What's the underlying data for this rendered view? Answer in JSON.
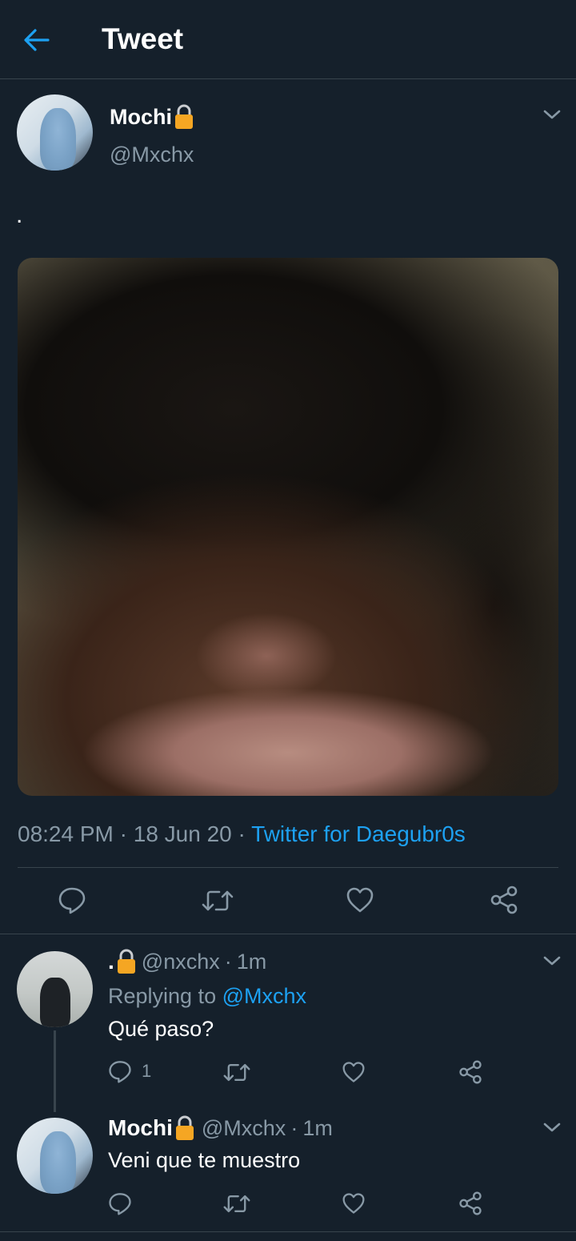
{
  "header": {
    "title": "Tweet",
    "back_icon": "arrow-left-icon"
  },
  "tweet": {
    "author_name": "Mochi",
    "author_handle": "@Mxchx",
    "text": ".",
    "time": "08:24 PM",
    "sep1": "·",
    "date": "18 Jun 20",
    "sep2": "·",
    "source": "Twitter for Daegubr0s"
  },
  "replies": [
    {
      "name": ".",
      "handle": "@nxchx",
      "sep": "·",
      "time": "1m",
      "replying_prefix": "Replying to",
      "replying_handle": "@Mxchx",
      "text": "Qué paso?",
      "reply_count": "1"
    },
    {
      "name": "Mochi",
      "handle": "@Mxchx",
      "sep": "·",
      "time": "1m",
      "text": "Veni que te muestro"
    }
  ],
  "colors": {
    "background": "#15202b",
    "accent": "#1da1f2",
    "muted": "#8899a6",
    "divider": "#38444d",
    "lock": "#f5a623"
  }
}
